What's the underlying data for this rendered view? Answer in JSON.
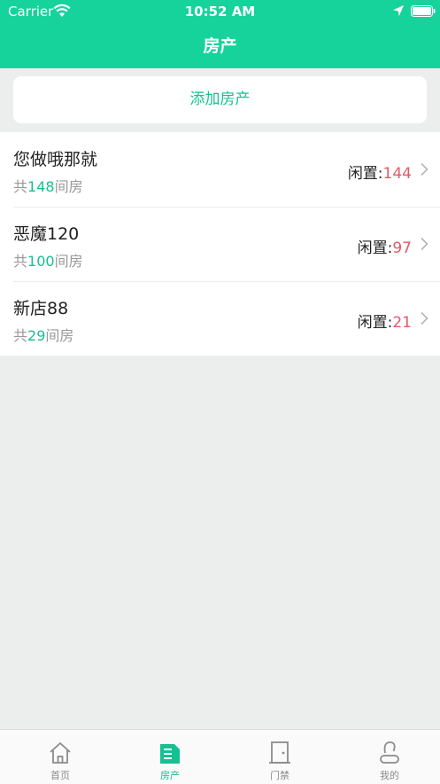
{
  "status_bar": {
    "carrier": "Carrier",
    "time": "10:52 AM"
  },
  "nav": {
    "title": "房产"
  },
  "add_button": {
    "label": "添加房产"
  },
  "properties": [
    {
      "name": "您做哦那就",
      "total_prefix": "共",
      "total": "148",
      "total_suffix": "间房",
      "idle_label": "闲置:",
      "idle": "144"
    },
    {
      "name": "恶魔120",
      "total_prefix": "共",
      "total": "100",
      "total_suffix": "间房",
      "idle_label": "闲置:",
      "idle": "97"
    },
    {
      "name": "新店88",
      "total_prefix": "共",
      "total": "29",
      "total_suffix": "间房",
      "idle_label": "闲置:",
      "idle": "21"
    }
  ],
  "tabbar": {
    "tabs": [
      {
        "label": "首页",
        "icon": "home-icon"
      },
      {
        "label": "房产",
        "icon": "document-icon"
      },
      {
        "label": "门禁",
        "icon": "door-icon"
      },
      {
        "label": "我的",
        "icon": "user-icon"
      }
    ],
    "active": "房产"
  },
  "colors": {
    "accent": "#16d39c",
    "idle": "#e05a6a",
    "background": "#eceeed"
  }
}
